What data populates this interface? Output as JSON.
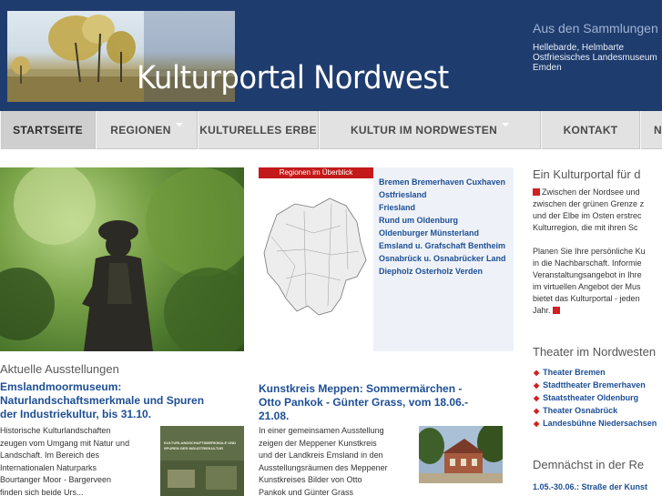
{
  "header": {
    "site_title": "Kulturportal Nordwest",
    "collection_heading": "Aus den Sammlungen",
    "collection_lines": [
      "Hellebarde, Helmbarte",
      "Ostfriesisches Landesmuseum",
      "Emden"
    ]
  },
  "nav": {
    "items": [
      {
        "label": "STARTSEITE",
        "active": true
      },
      {
        "label": "REGIONEN",
        "dropdown": true
      },
      {
        "label": "KULTURELLES ERBE"
      },
      {
        "label": "KULTUR IM NORDWESTEN",
        "dropdown": true
      },
      {
        "label": "KONTAKT"
      },
      {
        "label": "N"
      }
    ]
  },
  "map": {
    "header": "Regionen im Überblick",
    "regions": [
      "Bremen Bremerhaven Cuxhaven",
      "Ostfriesland",
      "Friesland",
      "Rund um Oldenburg",
      "Oldenburger Münsterland",
      "Emsland u. Grafschaft Bentheim",
      "Osnabrück u. Osnabrücker Land",
      "Diepholz Osterholz Verden"
    ]
  },
  "right": {
    "intro_heading": "Ein Kulturportal für d",
    "intro_lines": [
      "Zwischen der Nordsee und",
      "zwischen der grünen Grenze z",
      "und der Elbe im Osten erstrec",
      "Kulturregion, die mit ihren Sc",
      "",
      "Planen Sie Ihre persönliche Ku",
      "in die Nachbarschaft. Informie",
      "Veranstaltungsangebot in Ihre",
      "im virtuellen Angebot der Mus",
      "bietet das Kulturportal - jeden",
      "Jahr."
    ],
    "theatre_heading": "Theater im Nordwesten",
    "theatres": [
      "Theater Bremen",
      "Stadttheater Bremerhaven",
      "Staatstheater Oldenburg",
      "Theater Osnabrück",
      "Landesbühne Niedersachsen"
    ],
    "upcoming_heading": "Demnächst in der Re",
    "upcoming_item": "1.05.-30.06.: Straße der Kunst"
  },
  "exhibitions": {
    "section_title": "Aktuelle Ausstellungen",
    "items": [
      {
        "title_lines": [
          "Emslandmoormuseum:",
          "Naturlandschaftsmerkmale und Spuren",
          "der Industriekultur, bis 31.10."
        ],
        "text_lines": [
          "Historische Kulturlandschaften",
          "zeugen vom Umgang mit Natur und",
          "Landschaft. Im Bereich des",
          "Internationalen Naturparks",
          "Bourtanger Moor - Bargerveen",
          "finden sich beide Urs..."
        ],
        "image_caption": "KULTURLANDSCHAFTSMERKMALE UND SPUREN DER INDUSTRIEKULTUR"
      },
      {
        "title_lines": [
          "Kunstkreis Meppen: Sommermärchen -",
          "Otto Pankok - Günter Grass, vom 18.06.-",
          "21.08."
        ],
        "text_lines": [
          "In einer gemeinsamen Ausstellung",
          "zeigen der Meppener Kunstkreis",
          "und der Landkreis Emsland in den",
          "Ausstellungsräumen des Meppener",
          "Kunstkreises Bilder von Otto",
          "Pankok und Günter Grass"
        ]
      }
    ]
  },
  "colors": {
    "header_bg": "#1f3c6e",
    "nav_bg": "#e2e2e2",
    "link_blue": "#1d4f95",
    "accent_red": "#d21f1f"
  }
}
